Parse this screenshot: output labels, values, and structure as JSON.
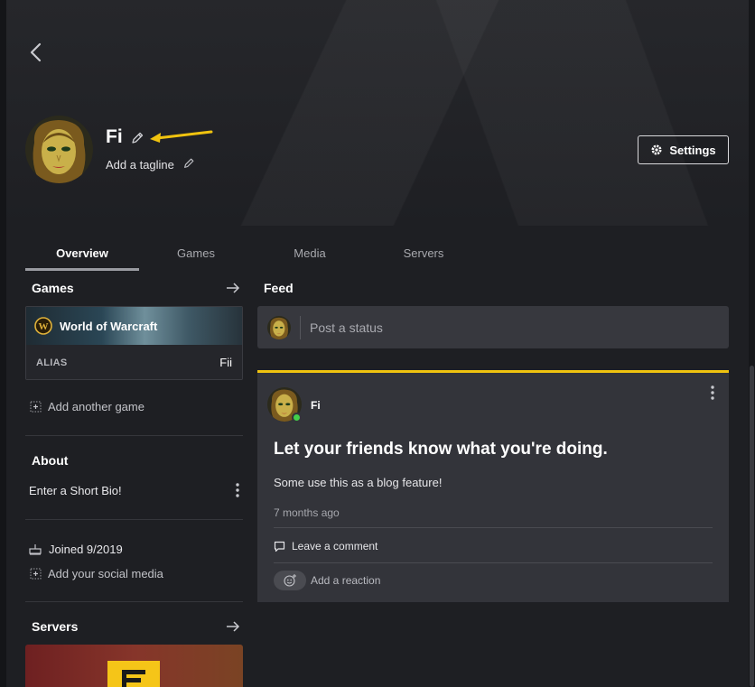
{
  "profile": {
    "name": "Fi",
    "tagline": "Add a tagline",
    "settings_label": "Settings"
  },
  "tabs": [
    {
      "label": "Overview",
      "active": true
    },
    {
      "label": "Games",
      "active": false
    },
    {
      "label": "Media",
      "active": false
    },
    {
      "label": "Servers",
      "active": false
    }
  ],
  "games_section": {
    "title": "Games",
    "game": {
      "name": "World of Warcraft",
      "alias_label": "ALIAS",
      "alias_value": "Fii"
    },
    "add_label": "Add another game"
  },
  "about": {
    "title": "About",
    "bio_placeholder": "Enter a Short Bio!",
    "joined": "Joined 9/2019",
    "social_label": "Add your social media"
  },
  "servers_section": {
    "title": "Servers"
  },
  "feed": {
    "title": "Feed",
    "post_placeholder": "Post a status",
    "card": {
      "author": "Fi",
      "headline": "Let your friends know what you're doing.",
      "body": "Some use this as a blog feature!",
      "time": "7 months ago",
      "comment_label": "Leave a comment",
      "reaction_label": "Add a reaction"
    }
  },
  "colors": {
    "accent": "#f0c30f",
    "online": "#43d04a",
    "background": "#1e1f23",
    "card": "#33343a"
  },
  "icons": {
    "back": "chevron-left-icon",
    "edit": "pencil-icon",
    "settings": "gear-icon",
    "arrow": "arrow-right-icon",
    "add": "plus-square-icon",
    "menu": "kebab-icon",
    "joined": "calendar-icon",
    "comment": "comment-icon",
    "reaction": "emoji-add-icon",
    "game": "wow-logo-icon"
  }
}
